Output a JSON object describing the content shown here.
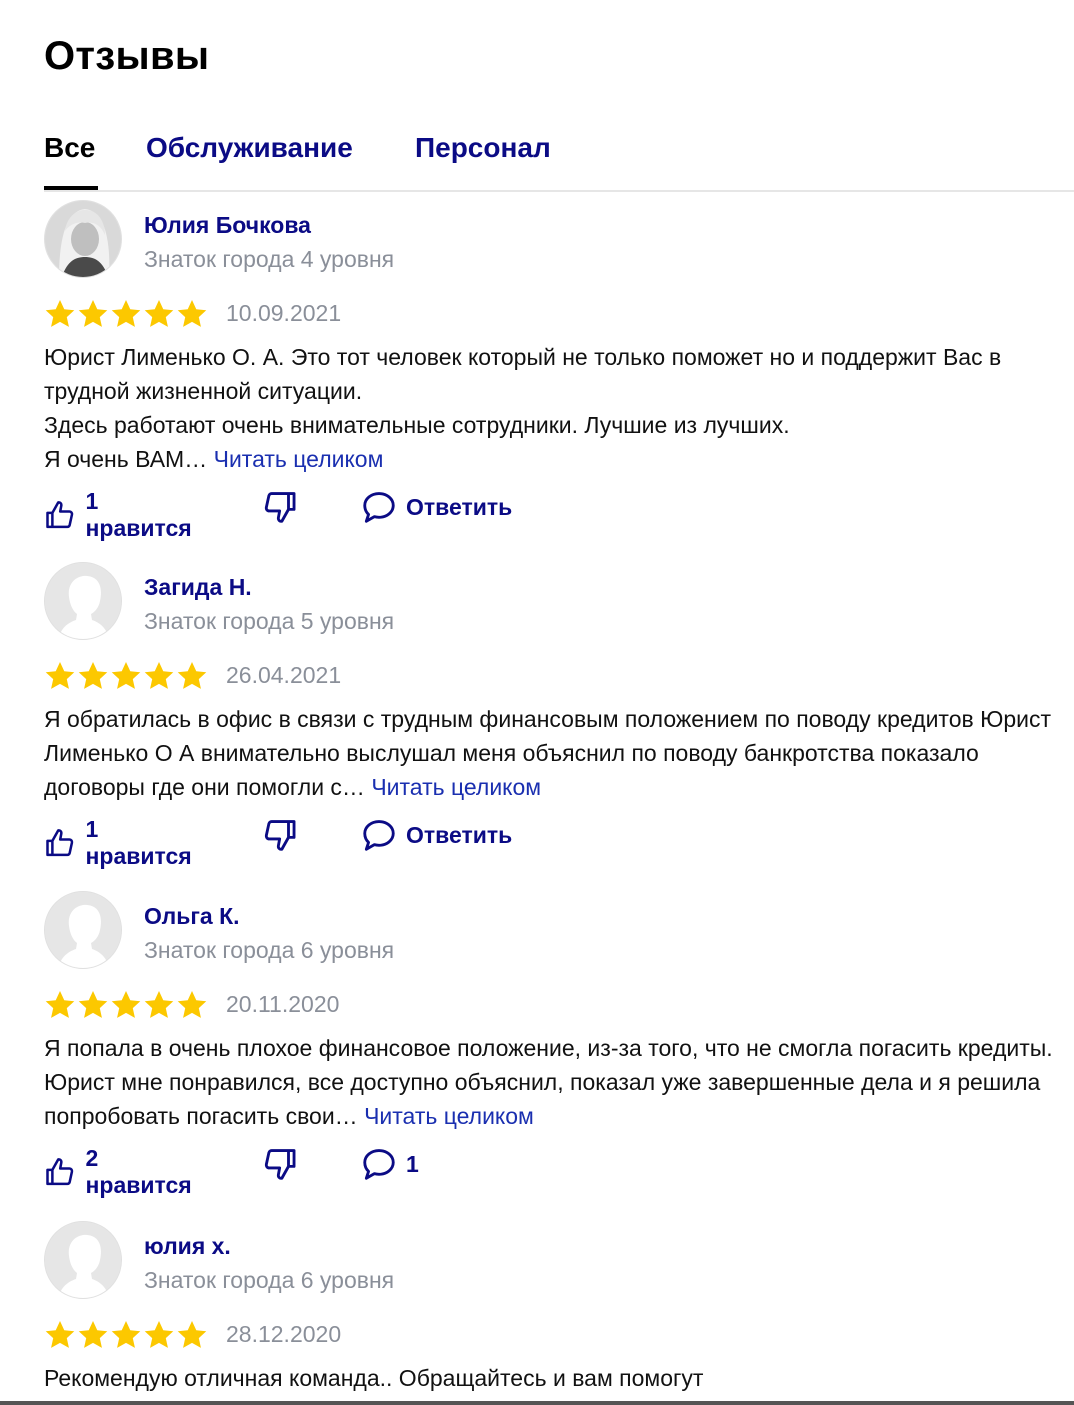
{
  "title": "Отзывы",
  "tabs": [
    {
      "label": "Все",
      "active": true
    },
    {
      "label": "Обслуживание",
      "active": false
    },
    {
      "label": "Персонал",
      "active": false
    }
  ],
  "colors": {
    "accent": "#0b0b85",
    "star": "#fcc800",
    "muted": "#8a8f99"
  },
  "reviews": [
    {
      "author": "Юлия Бочкова",
      "level": "Знаток города 4 уровня",
      "rating": 5,
      "date": "10.09.2021",
      "text": "Юрист Лименько О. А. Это тот человек который не только поможет но и поддержит Вас в трудной жизненной ситуации.\nЗдесь работают очень внимательные сотрудники. Лучшие из лучших.\nЯ очень ВАМ…",
      "read_more": "Читать целиком",
      "likes_label": "1 нравится",
      "reply_label": "Ответить",
      "avatar": "photo-avatar"
    },
    {
      "author": "Загида Н.",
      "level": "Знаток города 5 уровня",
      "rating": 5,
      "date": "26.04.2021",
      "text": "Я обратилась в офис в связи с трудным финансовым положением по поводу кредитов Юрист Лименько О А внимательно выслушал меня объяснил по поводу банкротства показало договоры где они помогли с…",
      "read_more": "Читать целиком",
      "likes_label": "1 нравится",
      "reply_label": "Ответить",
      "avatar": "default-avatar"
    },
    {
      "author": "Ольга К.",
      "level": "Знаток города 6 уровня",
      "rating": 5,
      "date": "20.11.2020",
      "text": "Я попала в очень плохое финансовое положение, из-за того, что не смогла погасить кредиты. Юрист мне понравился, все доступно объяснил, показал уже завершенные дела и я решила попробовать погасить свои…",
      "read_more": "Читать целиком",
      "likes_label": "2 нравится",
      "reply_label": "1",
      "avatar": "default-avatar"
    },
    {
      "author": "юлия х.",
      "level": "Знаток города 6 уровня",
      "rating": 5,
      "date": "28.12.2020",
      "text": "Рекомендую отличная команда.. Обращайтесь и вам помогут",
      "read_more": "",
      "likes_label": "",
      "reply_label": "",
      "avatar": "default-avatar"
    }
  ]
}
